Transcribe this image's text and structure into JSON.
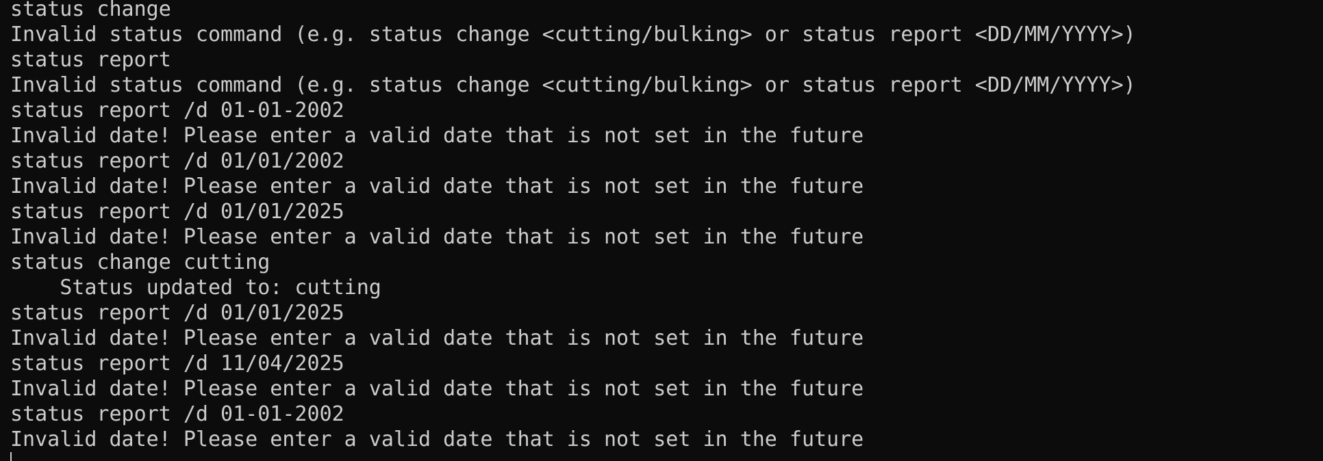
{
  "terminal": {
    "lines": [
      "status change",
      "Invalid status command (e.g. status change <cutting/bulking> or status report <DD/MM/YYYY>)",
      "status report",
      "Invalid status command (e.g. status change <cutting/bulking> or status report <DD/MM/YYYY>)",
      "status report /d 01-01-2002",
      "Invalid date! Please enter a valid date that is not set in the future",
      "status report /d 01/01/2002",
      "Invalid date! Please enter a valid date that is not set in the future",
      "status report /d 01/01/2025",
      "Invalid date! Please enter a valid date that is not set in the future",
      "status change cutting",
      "    Status updated to: cutting",
      "status report /d 01/01/2025",
      "Invalid date! Please enter a valid date that is not set in the future",
      "status report /d 11/04/2025",
      "Invalid date! Please enter a valid date that is not set in the future",
      "status report /d 01-01-2002",
      "Invalid date! Please enter a valid date that is not set in the future"
    ],
    "colors": {
      "background": "#0c0c0c",
      "text": "#cccccc"
    }
  }
}
